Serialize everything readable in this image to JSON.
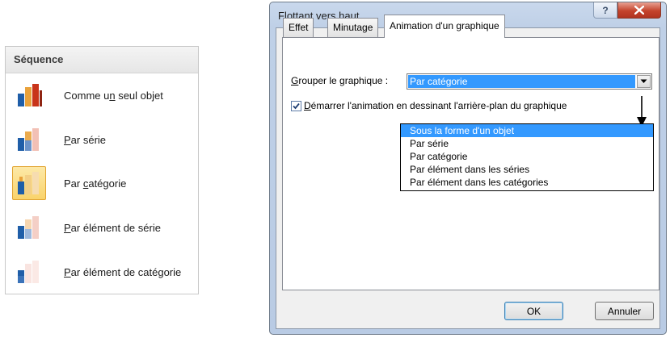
{
  "sequence_panel": {
    "title": "Séquence",
    "items": [
      {
        "pre": "Comme u",
        "u": "n",
        "post": " seul objet",
        "icon": "chart-single-object-icon",
        "selected": false
      },
      {
        "pre": "",
        "u": "P",
        "post": "ar série",
        "icon": "chart-by-series-icon",
        "selected": false
      },
      {
        "pre": "Par ",
        "u": "c",
        "post": "atégorie",
        "icon": "chart-by-category-icon",
        "selected": true
      },
      {
        "pre": "",
        "u": "P",
        "post": "ar élément de série",
        "icon": "chart-by-series-element-icon",
        "selected": false
      },
      {
        "pre": "",
        "u": "P",
        "post": "ar élément de catégorie",
        "icon": "chart-by-category-element-icon",
        "selected": false
      }
    ]
  },
  "dialog": {
    "title": "Flottant vers haut",
    "help_label": "?",
    "tabs": [
      {
        "label": "Effet",
        "active": false
      },
      {
        "label": "Minutage",
        "active": false
      },
      {
        "label": "Animation d'un graphique",
        "active": true
      }
    ],
    "group_label_u": "G",
    "group_label_rest": "rouper le graphique :",
    "group_value": "Par catégorie",
    "checkbox_checked": true,
    "checkbox_u": "D",
    "checkbox_rest": "émarrer l'animation en dessinant l'arrière-plan du graphique",
    "dropdown_options": [
      "Sous la forme d'un objet",
      "Par série",
      "Par catégorie",
      "Par élément dans les séries",
      "Par élément dans les catégories"
    ],
    "dropdown_selected_index": 0,
    "ok_label": "OK",
    "cancel_label": "Annuler"
  },
  "colors": {
    "selection_blue": "#3399ff",
    "bar_red": "#c8341a",
    "bar_orange": "#e9a23b",
    "bar_blue": "#1f5ea8",
    "selected_tile": "#f9d36b"
  }
}
